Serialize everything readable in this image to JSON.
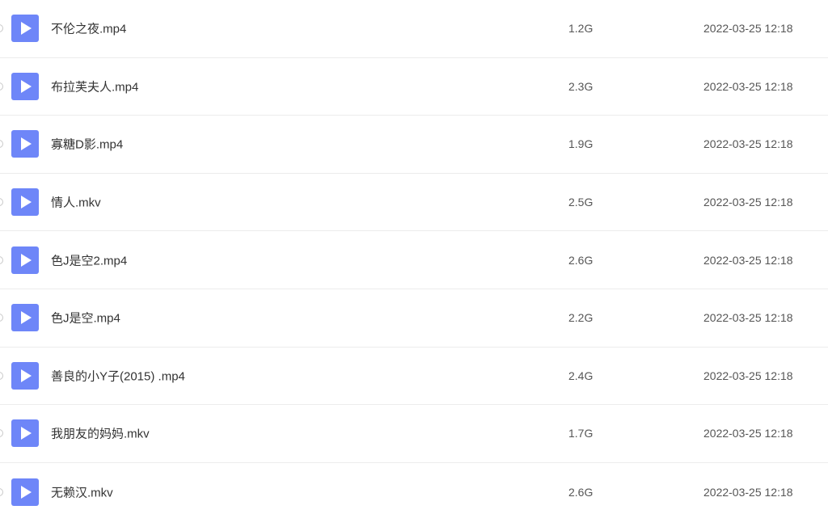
{
  "files": [
    {
      "name": "不伦之夜.mp4",
      "size": "1.2G",
      "date": "2022-03-25 12:18",
      "icon": "play-icon"
    },
    {
      "name": "布拉芙夫人.mp4",
      "size": "2.3G",
      "date": "2022-03-25 12:18",
      "icon": "play-icon"
    },
    {
      "name": "寡糖D影.mp4",
      "size": "1.9G",
      "date": "2022-03-25 12:18",
      "icon": "play-icon"
    },
    {
      "name": "情人.mkv",
      "size": "2.5G",
      "date": "2022-03-25 12:18",
      "icon": "play-icon"
    },
    {
      "name": "色J是空2.mp4",
      "size": "2.6G",
      "date": "2022-03-25 12:18",
      "icon": "play-icon"
    },
    {
      "name": "色J是空.mp4",
      "size": "2.2G",
      "date": "2022-03-25 12:18",
      "icon": "play-icon"
    },
    {
      "name": "善良的小Y子(2015) .mp4",
      "size": "2.4G",
      "date": "2022-03-25 12:18",
      "icon": "play-icon"
    },
    {
      "name": "我朋友的妈妈.mkv",
      "size": "1.7G",
      "date": "2022-03-25 12:18",
      "icon": "play-icon"
    },
    {
      "name": "无赖汉.mkv",
      "size": "2.6G",
      "date": "2022-03-25 12:18",
      "icon": "play-icon"
    }
  ],
  "colors": {
    "icon_bg": "#6e86f8",
    "divider": "#ececec",
    "text": "#333333"
  }
}
